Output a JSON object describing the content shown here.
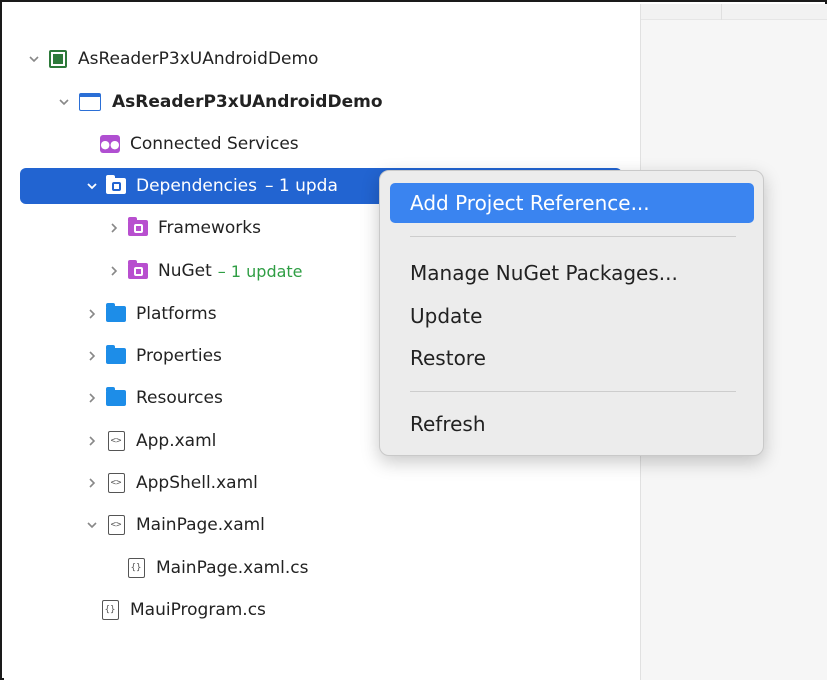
{
  "tree": {
    "solution": {
      "label": "AsReaderP3xUAndroidDemo",
      "icon": "solution-icon"
    },
    "project": {
      "label": "AsReaderP3xUAndroidDemo",
      "icon": "project-icon"
    },
    "connected_services": {
      "label": "Connected Services",
      "icon": "connected-services-icon"
    },
    "dependencies": {
      "label": "Dependencies",
      "badge": "– 1 upda",
      "icon": "dependencies-folder-icon"
    },
    "frameworks": {
      "label": "Frameworks",
      "icon": "purple-folder-icon"
    },
    "nuget": {
      "label": "NuGet",
      "badge": "– 1 update",
      "icon": "purple-folder-icon"
    },
    "platforms": {
      "label": "Platforms",
      "icon": "folder-icon"
    },
    "properties": {
      "label": "Properties",
      "icon": "folder-icon"
    },
    "resources": {
      "label": "Resources",
      "icon": "folder-icon"
    },
    "app_xaml": {
      "label": "App.xaml",
      "icon": "xaml-file-icon"
    },
    "appshell_xaml": {
      "label": "AppShell.xaml",
      "icon": "xaml-file-icon"
    },
    "mainpage_xaml": {
      "label": "MainPage.xaml",
      "icon": "xaml-file-icon"
    },
    "mainpage_cs": {
      "label": "MainPage.xaml.cs",
      "icon": "cs-file-icon"
    },
    "mauiprogram_cs": {
      "label": "MauiProgram.cs",
      "icon": "cs-file-icon"
    }
  },
  "context_menu": {
    "items": [
      {
        "label": "Add Project Reference...",
        "highlighted": true
      },
      {
        "label": "Manage NuGet Packages..."
      },
      {
        "label": "Update"
      },
      {
        "label": "Restore"
      },
      {
        "label": "Refresh"
      }
    ]
  },
  "colors": {
    "selection": "#2264d1",
    "menu_highlight": "#3a84f0",
    "update_badge": "#2f9e44",
    "folder": "#1d8de8",
    "purple_folder": "#b84fcf"
  }
}
